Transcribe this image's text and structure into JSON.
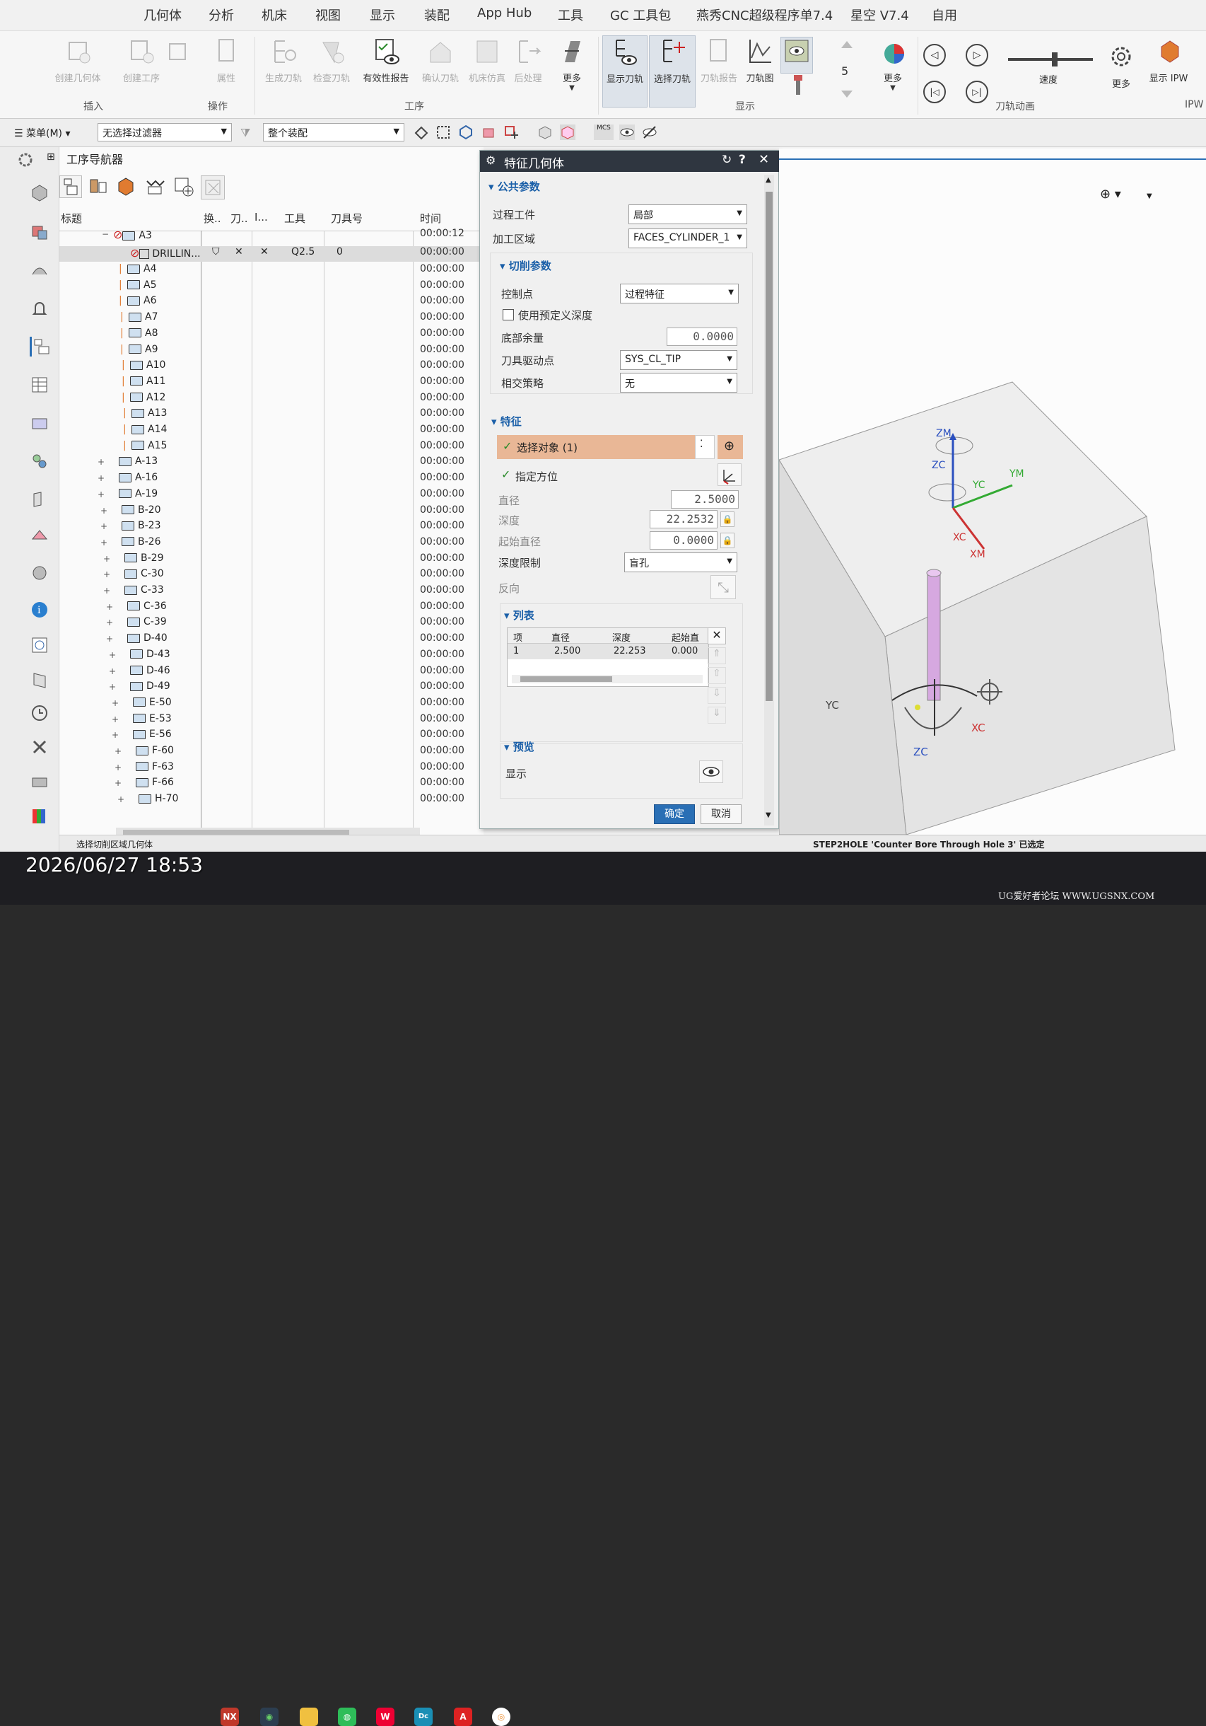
{
  "menubar": {
    "items": [
      "几何体",
      "分析",
      "机床",
      "视图",
      "显示",
      "装配",
      "App Hub",
      "工具",
      "GC 工具包",
      "燕秀CNC超级程序单7.4",
      "星空 V7.4",
      "自用"
    ]
  },
  "ribbon": {
    "buttons": [
      "创建几何体",
      "创建工序",
      "属性",
      "生成刀轨",
      "检查刀轨",
      "有效性报告",
      "确认刀轨",
      "机床仿真",
      "后处理",
      "更多",
      "显示刀轨",
      "选择刀轨",
      "刀轨报告",
      "刀轨图",
      "更多",
      "更多",
      "显示 IPW"
    ],
    "groups": [
      "插入",
      "操作",
      "工序",
      "显示",
      "刀轨动画",
      "IPW"
    ],
    "speed_label": "速度",
    "speed_level": 0.55
  },
  "toolbar": {
    "menu_label": "菜单(M)",
    "filter_value": "无选择过滤器",
    "scope_value": "整个装配",
    "mcs_label": "MCS"
  },
  "navigator": {
    "title": "工序导航器",
    "columns": [
      "标题",
      "换..",
      "刀..",
      "I...",
      "工具",
      "刀具号",
      "时间"
    ],
    "parent": {
      "name": "A3",
      "time": "00:00:12"
    },
    "selected": {
      "name": "DRILLIN...",
      "tool": "Q2.5",
      "tool_number": "0",
      "time": "00:00:00"
    },
    "rows": [
      {
        "name": "A4",
        "time": "00:00:00"
      },
      {
        "name": "A5",
        "time": "00:00:00"
      },
      {
        "name": "A6",
        "time": "00:00:00"
      },
      {
        "name": "A7",
        "time": "00:00:00"
      },
      {
        "name": "A8",
        "time": "00:00:00"
      },
      {
        "name": "A9",
        "time": "00:00:00"
      },
      {
        "name": "A10",
        "time": "00:00:00"
      },
      {
        "name": "A11",
        "time": "00:00:00"
      },
      {
        "name": "A12",
        "time": "00:00:00"
      },
      {
        "name": "A13",
        "time": "00:00:00"
      },
      {
        "name": "A14",
        "time": "00:00:00"
      },
      {
        "name": "A15",
        "time": "00:00:00"
      },
      {
        "name": "A-13",
        "time": "00:00:00"
      },
      {
        "name": "A-16",
        "time": "00:00:00"
      },
      {
        "name": "A-19",
        "time": "00:00:00"
      },
      {
        "name": "B-20",
        "time": "00:00:00"
      },
      {
        "name": "B-23",
        "time": "00:00:00"
      },
      {
        "name": "B-26",
        "time": "00:00:00"
      },
      {
        "name": "B-29",
        "time": "00:00:00"
      },
      {
        "name": "C-30",
        "time": "00:00:00"
      },
      {
        "name": "C-33",
        "time": "00:00:00"
      },
      {
        "name": "C-36",
        "time": "00:00:00"
      },
      {
        "name": "C-39",
        "time": "00:00:00"
      },
      {
        "name": "D-40",
        "time": "00:00:00"
      },
      {
        "name": "D-43",
        "time": "00:00:00"
      },
      {
        "name": "D-46",
        "time": "00:00:00"
      },
      {
        "name": "D-49",
        "time": "00:00:00"
      },
      {
        "name": "E-50",
        "time": "00:00:00"
      },
      {
        "name": "E-53",
        "time": "00:00:00"
      },
      {
        "name": "E-56",
        "time": "00:00:00"
      },
      {
        "name": "F-60",
        "time": "00:00:00"
      },
      {
        "name": "F-63",
        "time": "00:00:00"
      },
      {
        "name": "F-66",
        "time": "00:00:00"
      },
      {
        "name": "H-70",
        "time": "00:00:00"
      }
    ]
  },
  "dialog": {
    "title": "特征几何体",
    "common_params": "公共参数",
    "process_workpiece_label": "过程工件",
    "process_workpiece_value": "局部",
    "machining_area_label": "加工区域",
    "machining_area_value": "FACES_CYLINDER_1",
    "cut_params": "切削参数",
    "control_point_label": "控制点",
    "control_point_value": "过程特征",
    "use_predefined_depth": "使用预定义深度",
    "bottom_stock_label": "底部余量",
    "bottom_stock_value": "0.0000",
    "tool_drive_point_label": "刀具驱动点",
    "tool_drive_point_value": "SYS_CL_TIP",
    "intersect_strategy_label": "相交策略",
    "intersect_strategy_value": "无",
    "feature": "特征",
    "select_object": "选择对象 (1)",
    "specify_orientation": "指定方位",
    "diameter_label": "直径",
    "diameter_value": "2.5000",
    "depth_label": "深度",
    "depth_value": "22.2532",
    "start_diameter_label": "起始直径",
    "start_diameter_value": "0.0000",
    "depth_limit_label": "深度限制",
    "depth_limit_value": "盲孔",
    "reverse_label": "反向",
    "list": "列表",
    "table_headers": [
      "项",
      "直径",
      "深度",
      "起始直"
    ],
    "table_row": [
      "1",
      "2.500",
      "22.253",
      "0.000"
    ],
    "preview": "预览",
    "display_label": "显示",
    "ok": "确定",
    "cancel": "取消"
  },
  "viewport": {
    "axis_labels": [
      "ZM",
      "ZC",
      "YC",
      "YM",
      "XC",
      "XM",
      "YC",
      "XC",
      "ZC"
    ]
  },
  "status": {
    "left": "选择切削区域几何体",
    "right": "STEP2HOLE 'Counter Bore Through Hole 3' 已选定"
  },
  "overlay": {
    "datetime": "2026/06/27 18:53",
    "watermark": "UG爱好者论坛 WWW.UGSNX.COM"
  },
  "taskbar": [
    "NX",
    "",
    "",
    "",
    "W",
    "Dc",
    "A",
    ""
  ]
}
